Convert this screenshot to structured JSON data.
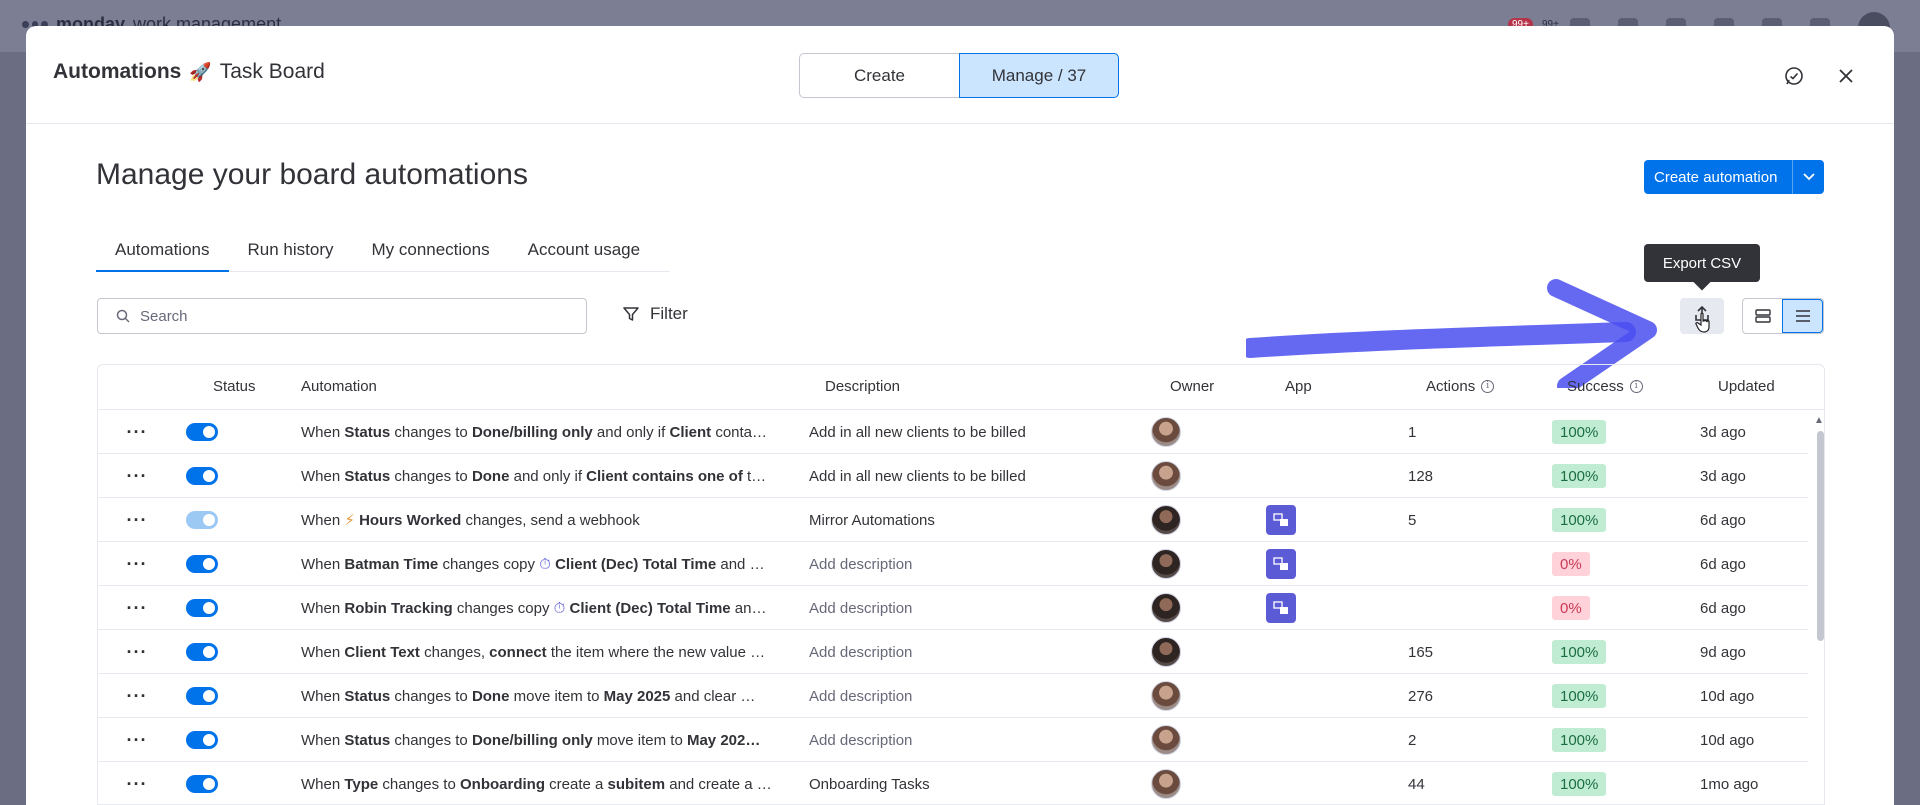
{
  "background": {
    "brand": "monday",
    "brand_suffix": "work management",
    "badge_1": "99+",
    "badge_2": "99+"
  },
  "modal": {
    "title_bold": "Automations",
    "title_icon": "rocket-icon",
    "title_rest": "Task Board",
    "segments": [
      {
        "label": "Create"
      },
      {
        "label": "Manage / 37"
      }
    ]
  },
  "page": {
    "heading": "Manage your board automations",
    "create_button": "Create automation",
    "tabs": [
      {
        "label": "Automations"
      },
      {
        "label": "Run history"
      },
      {
        "label": "My connections"
      },
      {
        "label": "Account usage"
      }
    ],
    "search_placeholder": "Search",
    "filter_label": "Filter",
    "tooltip": "Export CSV"
  },
  "table": {
    "headers": {
      "status": "Status",
      "automation": "Automation",
      "description": "Description",
      "owner": "Owner",
      "app": "App",
      "actions": "Actions",
      "success": "Success",
      "updated": "Updated"
    },
    "rows": [
      {
        "parts": [
          [
            "When ",
            0
          ],
          [
            "Status",
            1
          ],
          [
            " changes to ",
            0
          ],
          [
            "Done/billing only",
            1
          ],
          [
            " and only if ",
            0
          ],
          [
            "Client",
            1
          ],
          [
            " conta…",
            0
          ]
        ],
        "description": "Add in all new clients to be billed",
        "desc_muted": false,
        "owner": "light",
        "app": false,
        "actions": "1",
        "success": "100%",
        "ok": true,
        "updated": "3d ago",
        "enabled": true
      },
      {
        "parts": [
          [
            "When ",
            0
          ],
          [
            "Status",
            1
          ],
          [
            " changes to ",
            0
          ],
          [
            "Done",
            1
          ],
          [
            " and only if ",
            0
          ],
          [
            "Client",
            1
          ],
          [
            " ",
            0
          ],
          [
            "contains one of",
            1
          ],
          [
            " t…",
            0
          ]
        ],
        "description": "Add in all new clients to be billed",
        "desc_muted": false,
        "owner": "light",
        "app": false,
        "actions": "128",
        "success": "100%",
        "ok": true,
        "updated": "3d ago",
        "enabled": true
      },
      {
        "parts": [
          [
            "When ",
            0
          ],
          [
            "⚡ ",
            2
          ],
          [
            "Hours Worked",
            1
          ],
          [
            " changes, send a webhook",
            0
          ]
        ],
        "description": "Mirror Automations",
        "desc_muted": false,
        "owner": "dark",
        "app": true,
        "actions": "5",
        "success": "100%",
        "ok": true,
        "updated": "6d ago",
        "enabled": false
      },
      {
        "parts": [
          [
            "When ",
            0
          ],
          [
            "Batman Time",
            1
          ],
          [
            " changes copy ",
            0
          ],
          [
            "⏱ ",
            3
          ],
          [
            "Client (Dec) Total Time",
            1
          ],
          [
            " and …",
            0
          ]
        ],
        "description": "Add description",
        "desc_muted": true,
        "owner": "dark",
        "app": true,
        "actions": "",
        "success": "0%",
        "ok": false,
        "updated": "6d ago",
        "enabled": true
      },
      {
        "parts": [
          [
            "When ",
            0
          ],
          [
            "Robin Tracking",
            1
          ],
          [
            " changes copy ",
            0
          ],
          [
            "⏱ ",
            3
          ],
          [
            "Client (Dec) Total Time",
            1
          ],
          [
            " an…",
            0
          ]
        ],
        "description": "Add description",
        "desc_muted": true,
        "owner": "dark",
        "app": true,
        "actions": "",
        "success": "0%",
        "ok": false,
        "updated": "6d ago",
        "enabled": true
      },
      {
        "parts": [
          [
            "When ",
            0
          ],
          [
            "Client Text",
            1
          ],
          [
            " changes, ",
            0
          ],
          [
            "connect",
            1
          ],
          [
            " the item where the new value …",
            0
          ]
        ],
        "description": "Add description",
        "desc_muted": true,
        "owner": "dark",
        "app": false,
        "actions": "165",
        "success": "100%",
        "ok": true,
        "updated": "9d ago",
        "enabled": true
      },
      {
        "parts": [
          [
            "When ",
            0
          ],
          [
            "Status",
            1
          ],
          [
            " changes to ",
            0
          ],
          [
            "Done",
            1
          ],
          [
            " move item to ",
            0
          ],
          [
            "May 2025",
            1
          ],
          [
            " and clear …",
            0
          ]
        ],
        "description": "Add description",
        "desc_muted": true,
        "owner": "light",
        "app": false,
        "actions": "276",
        "success": "100%",
        "ok": true,
        "updated": "10d ago",
        "enabled": true
      },
      {
        "parts": [
          [
            "When ",
            0
          ],
          [
            "Status",
            1
          ],
          [
            " changes to ",
            0
          ],
          [
            "Done/billing only",
            1
          ],
          [
            " move item to ",
            0
          ],
          [
            "May 202…",
            1
          ]
        ],
        "description": "Add description",
        "desc_muted": true,
        "owner": "light",
        "app": false,
        "actions": "2",
        "success": "100%",
        "ok": true,
        "updated": "10d ago",
        "enabled": true
      },
      {
        "parts": [
          [
            "When ",
            0
          ],
          [
            "Type",
            1
          ],
          [
            " changes to ",
            0
          ],
          [
            "Onboarding",
            1
          ],
          [
            " create a ",
            0
          ],
          [
            "subitem",
            1
          ],
          [
            " and create a …",
            0
          ]
        ],
        "description": "Onboarding Tasks",
        "desc_muted": false,
        "owner": "light",
        "app": false,
        "actions": "44",
        "success": "100%",
        "ok": true,
        "updated": "1mo ago",
        "enabled": true
      }
    ]
  },
  "colors": {
    "accent": "#0073ea",
    "success_bg": "#bfecd3",
    "fail_bg": "#ffd1d9",
    "annotation_arrow": "#4a4ff0"
  }
}
